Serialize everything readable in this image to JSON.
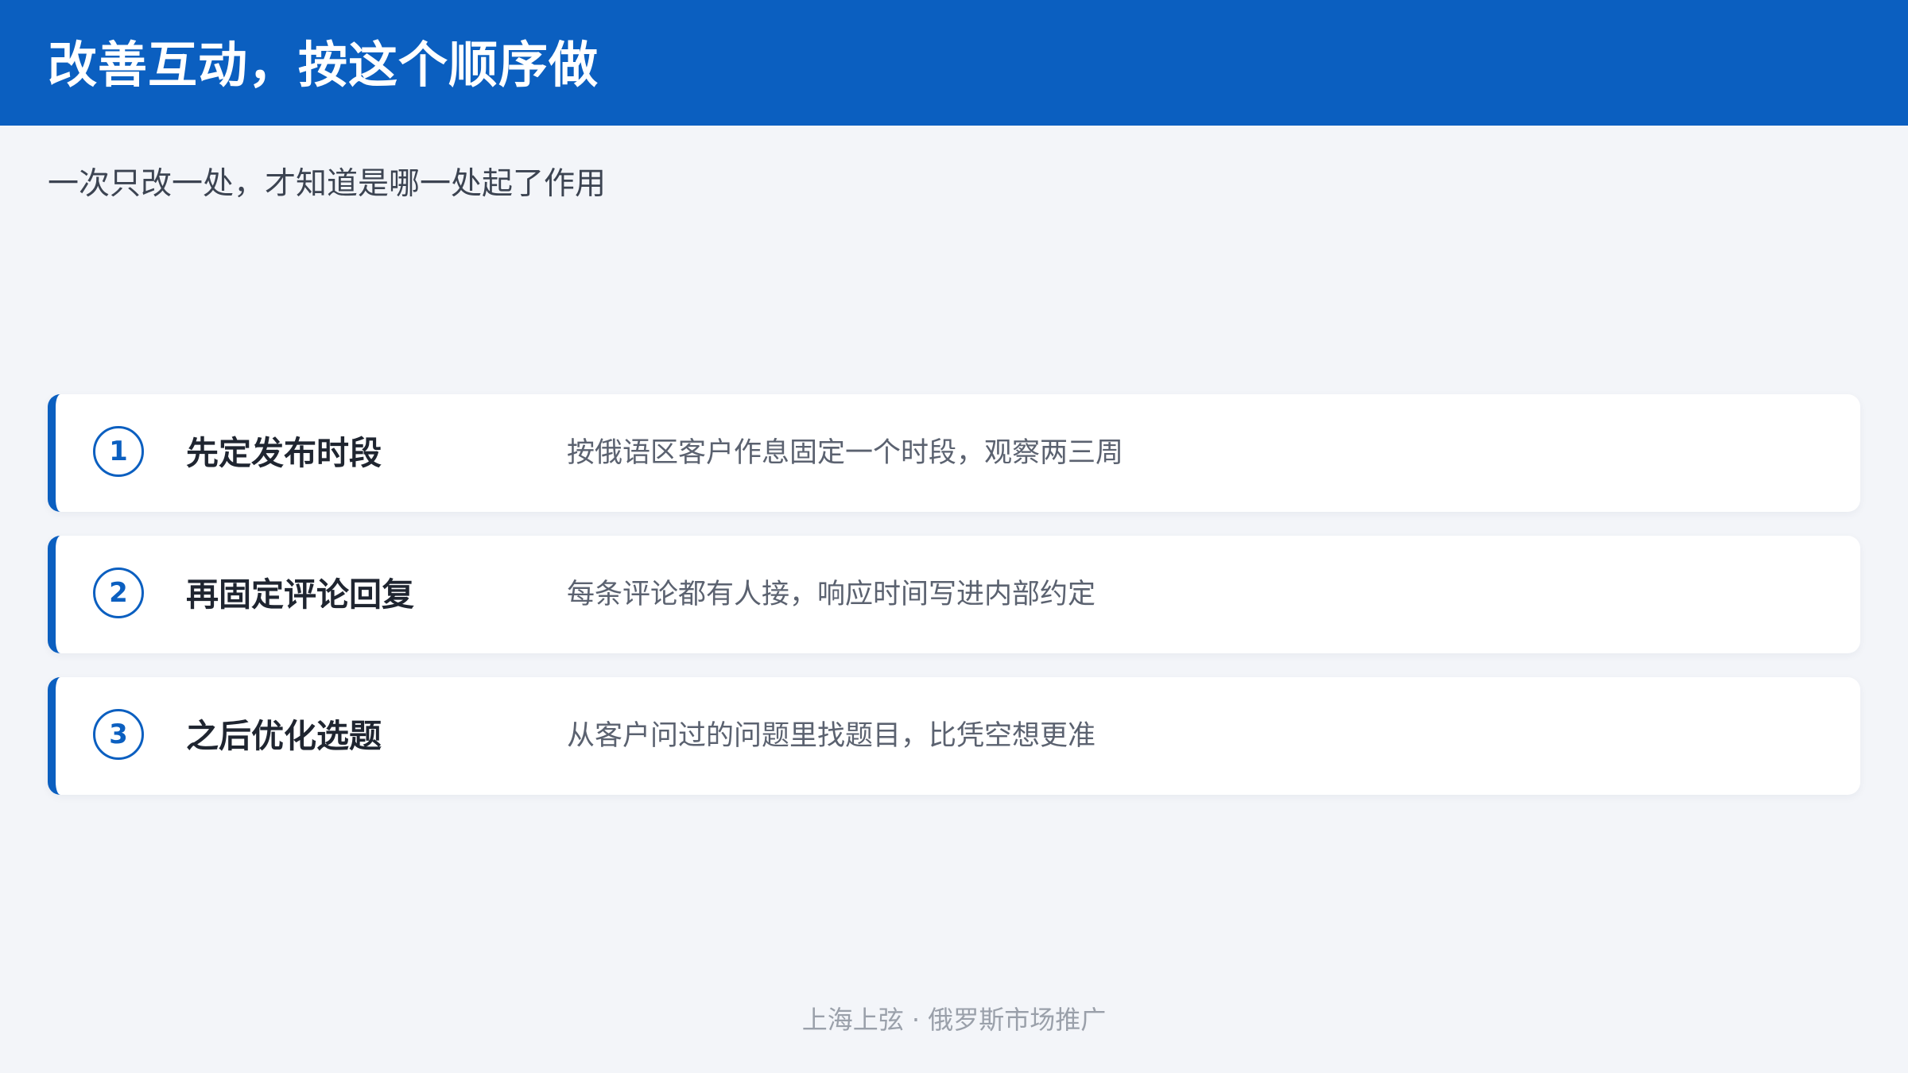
{
  "header": {
    "title": "改善互动，按这个顺序做"
  },
  "subtitle": "一次只改一处，才知道是哪一处起了作用",
  "steps": [
    {
      "number": "1",
      "title": "先定发布时段",
      "description": "按俄语区客户作息固定一个时段，观察两三周"
    },
    {
      "number": "2",
      "title": "再固定评论回复",
      "description": "每条评论都有人接，响应时间写进内部约定"
    },
    {
      "number": "3",
      "title": "之后优化选题",
      "description": "从客户问过的问题里找题目，比凭空想更准"
    }
  ],
  "footer": "上海上弦 · 俄罗斯市场推广",
  "colors": {
    "accent": "#0b5fc0",
    "background": "#f3f5f9",
    "card": "#ffffff",
    "title_text": "#1f2530",
    "body_text": "#5b6270",
    "footer_text": "#9aa0aa"
  }
}
